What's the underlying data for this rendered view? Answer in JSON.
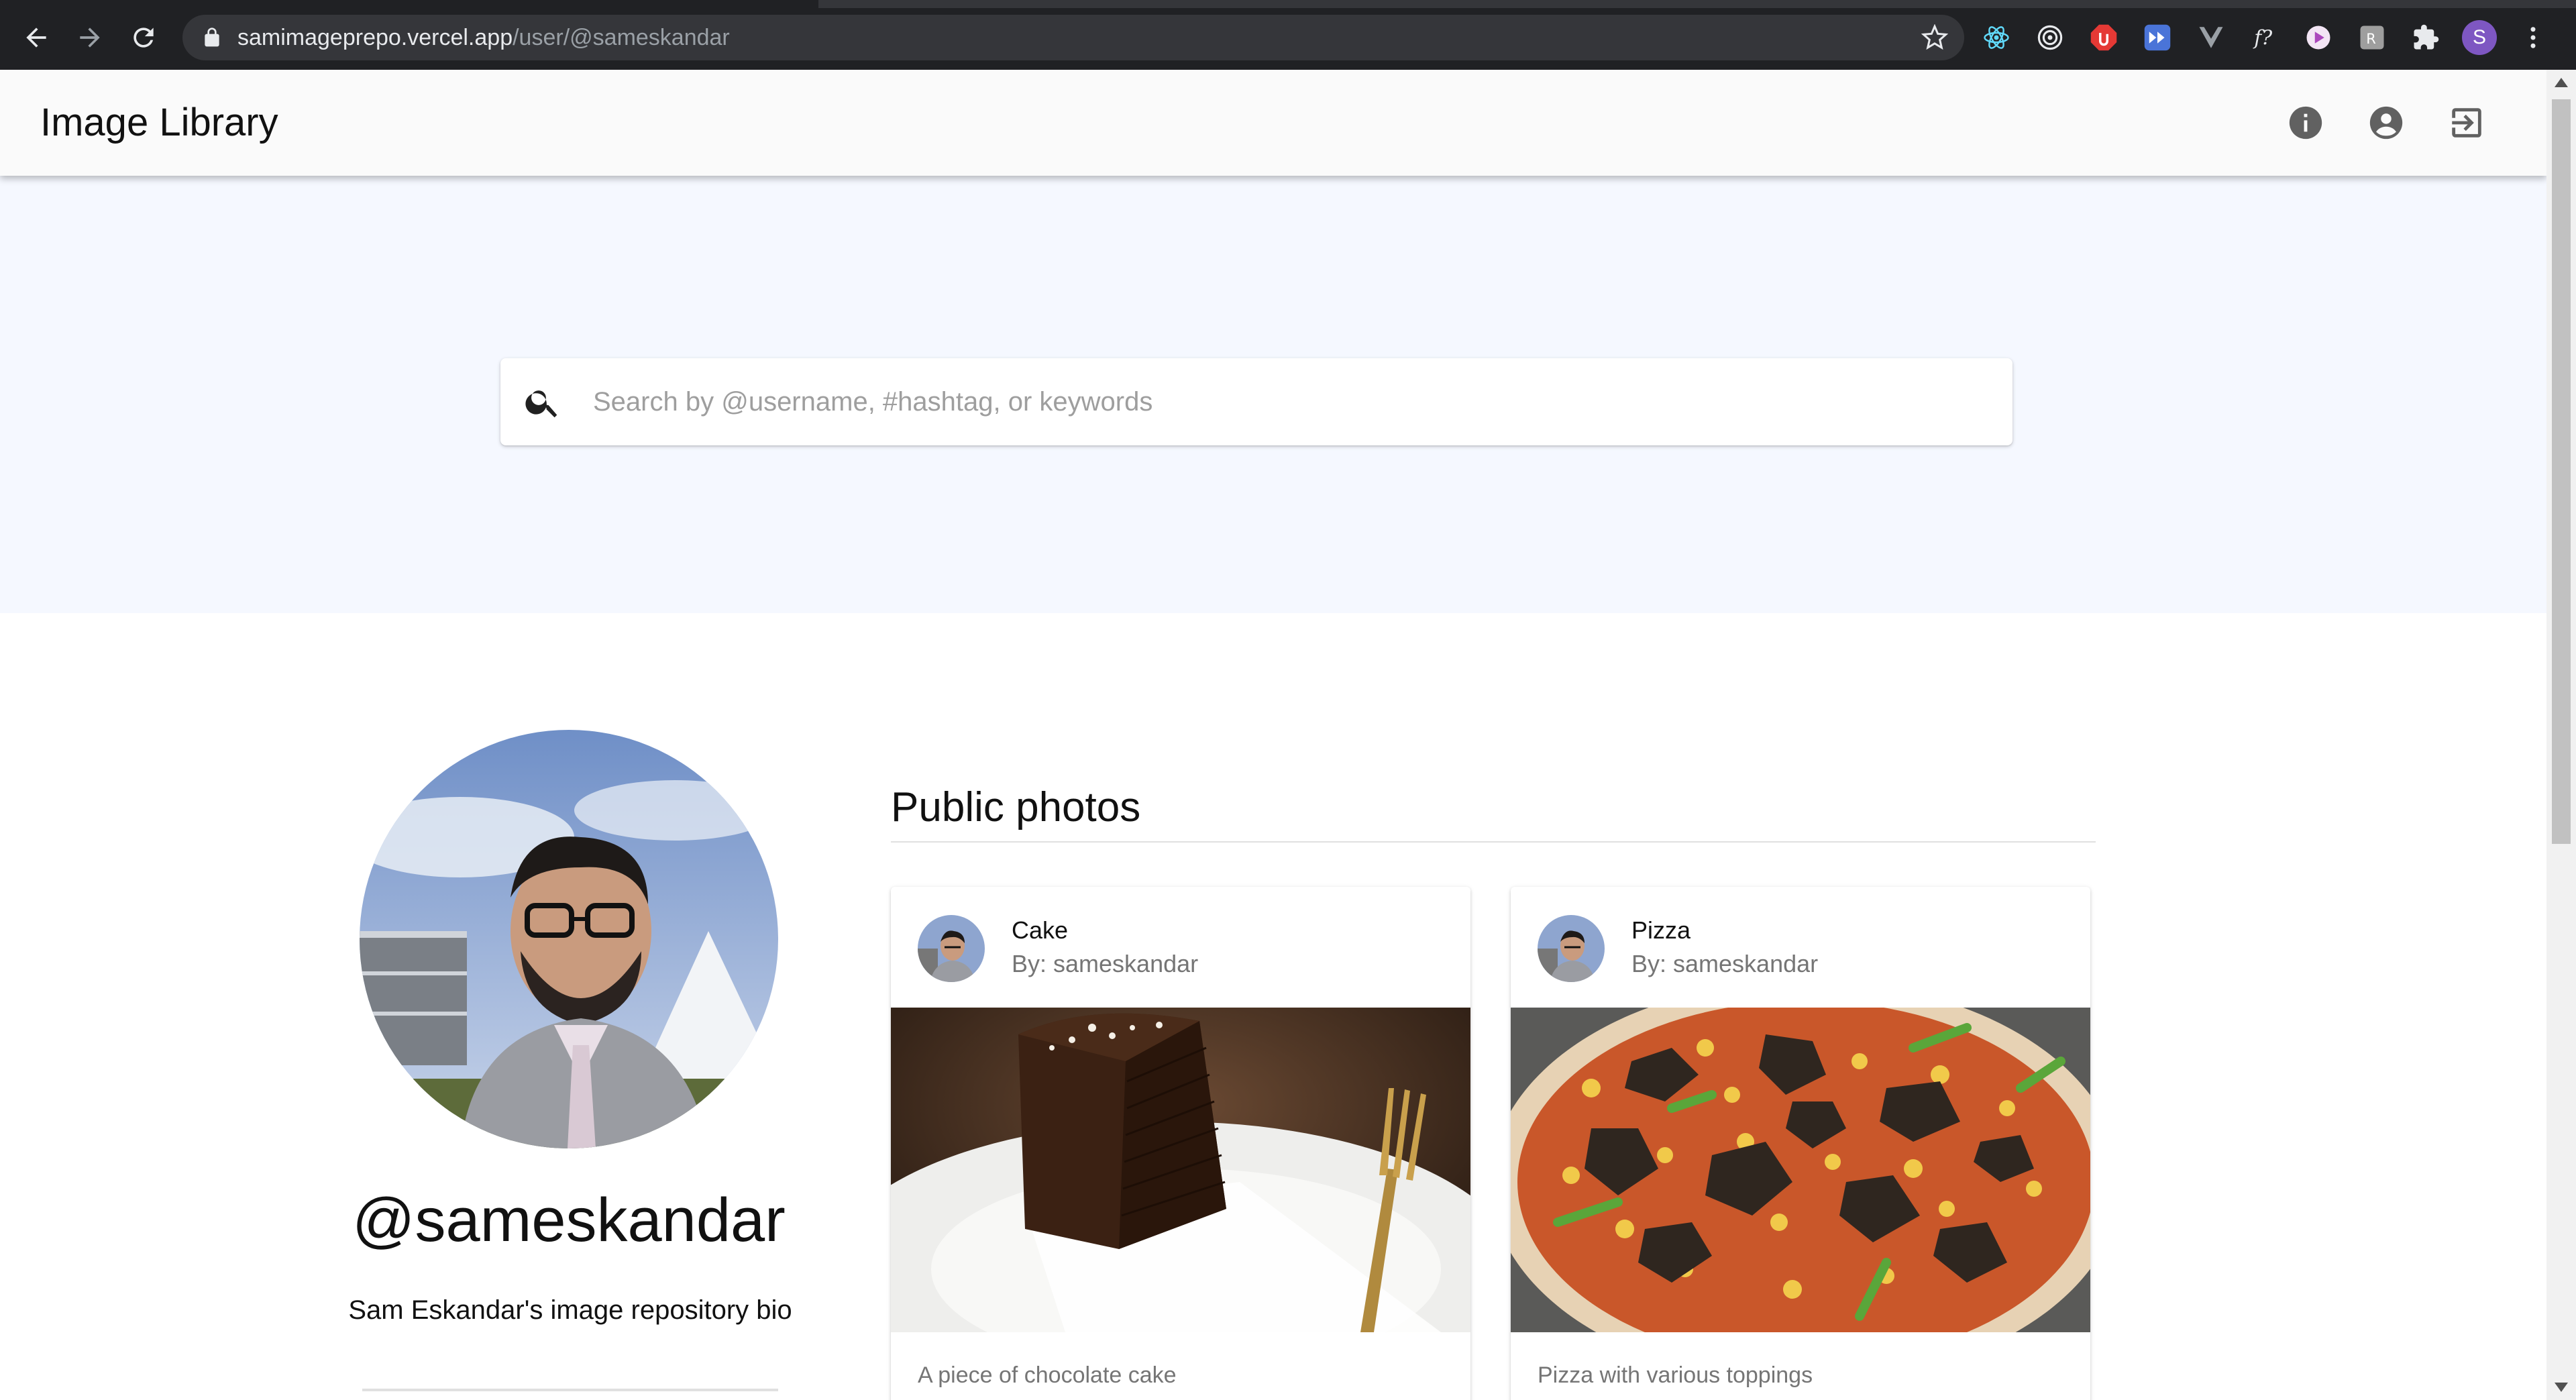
{
  "browser": {
    "url_host": "samimageprepo.vercel.app",
    "url_path": "/user/@sameskandar",
    "profile_initial": "S",
    "extensions": [
      "react-devtools-icon",
      "target-icon",
      "adblock-icon",
      "fast-forward-icon",
      "vue-icon",
      "formula-icon",
      "play-icon",
      "translate-icon",
      "puzzle-icon"
    ]
  },
  "app": {
    "title": "Image Library",
    "actions": [
      "info-icon",
      "account-icon",
      "logout-icon"
    ]
  },
  "search": {
    "placeholder": "Search by @username, #hashtag, or keywords"
  },
  "profile": {
    "username": "@sameskandar",
    "bio": "Sam Eskandar's image repository bio"
  },
  "gallery": {
    "title": "Public photos",
    "cards": [
      {
        "title": "Cake",
        "author": "By: sameskandar",
        "description": "A piece of chocolate cake"
      },
      {
        "title": "Pizza",
        "author": "By: sameskandar",
        "description": "Pizza with various toppings"
      }
    ]
  },
  "colors": {
    "hero_bg": "#f5f8ff",
    "appbar_bg": "#fafafa",
    "chrome_bg": "#202124"
  }
}
